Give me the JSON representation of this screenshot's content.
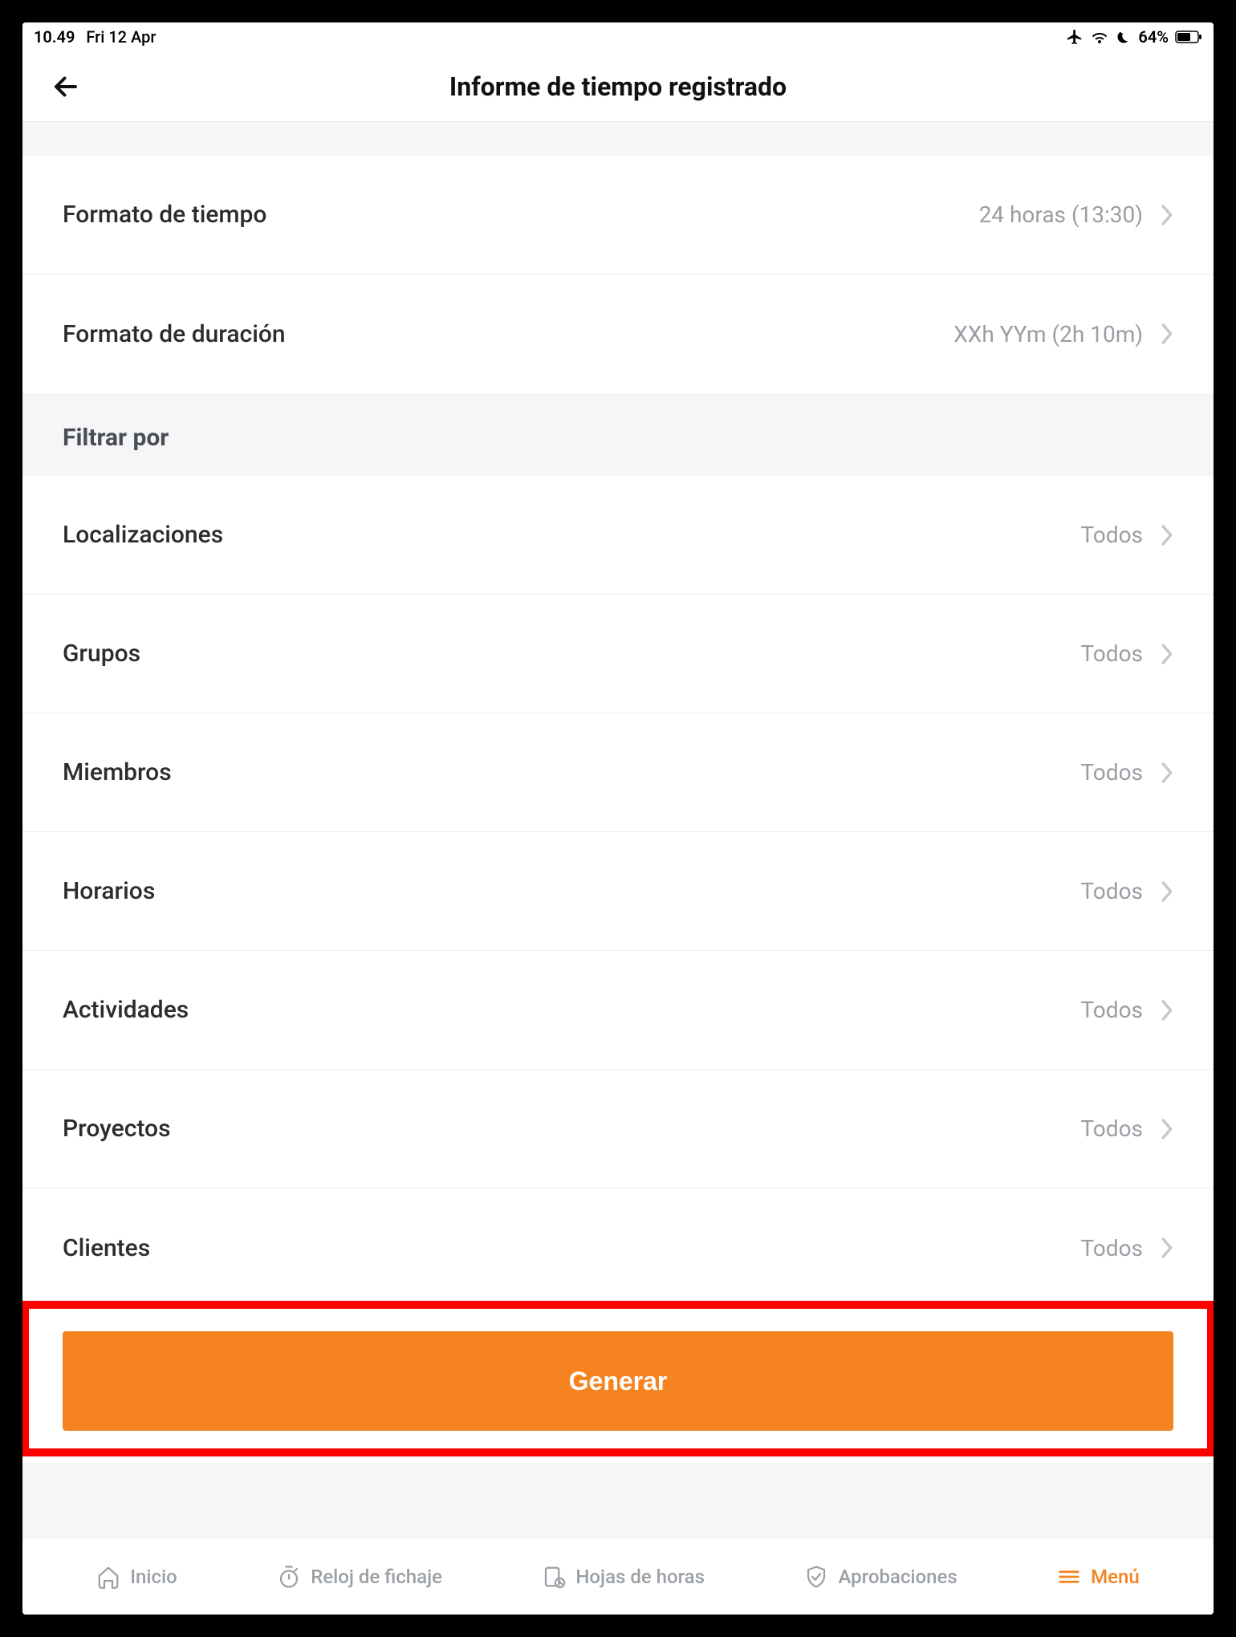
{
  "status": {
    "time": "10.49",
    "date": "Fri 12 Apr",
    "battery": "64%"
  },
  "header": {
    "title": "Informe de tiempo registrado"
  },
  "format_rows": [
    {
      "label": "Formato de tiempo",
      "value": "24 horas (13:30)",
      "name": "time-format-row"
    },
    {
      "label": "Formato de duración",
      "value": "XXh YYm (2h 10m)",
      "name": "duration-format-row"
    }
  ],
  "filter_section": {
    "title": "Filtrar por"
  },
  "filter_rows": [
    {
      "label": "Localizaciones",
      "value": "Todos",
      "name": "locations-row"
    },
    {
      "label": "Grupos",
      "value": "Todos",
      "name": "groups-row"
    },
    {
      "label": "Miembros",
      "value": "Todos",
      "name": "members-row"
    },
    {
      "label": "Horarios",
      "value": "Todos",
      "name": "schedules-row"
    },
    {
      "label": "Actividades",
      "value": "Todos",
      "name": "activities-row"
    },
    {
      "label": "Proyectos",
      "value": "Todos",
      "name": "projects-row"
    },
    {
      "label": "Clientes",
      "value": "Todos",
      "name": "clients-row"
    }
  ],
  "actions": {
    "generate": "Generar"
  },
  "tabs": [
    {
      "label": "Inicio",
      "name": "tab-home",
      "icon": "home-icon",
      "active": false
    },
    {
      "label": "Reloj de fichaje",
      "name": "tab-timeclock",
      "icon": "stopwatch-icon",
      "active": false
    },
    {
      "label": "Hojas de horas",
      "name": "tab-timesheets",
      "icon": "timesheet-icon",
      "active": false
    },
    {
      "label": "Aprobaciones",
      "name": "tab-approvals",
      "icon": "shield-check-icon",
      "active": false
    },
    {
      "label": "Menú",
      "name": "tab-menu",
      "icon": "menu-icon",
      "active": true
    }
  ],
  "colors": {
    "accent": "#f58320",
    "highlight": "#ff0000"
  }
}
